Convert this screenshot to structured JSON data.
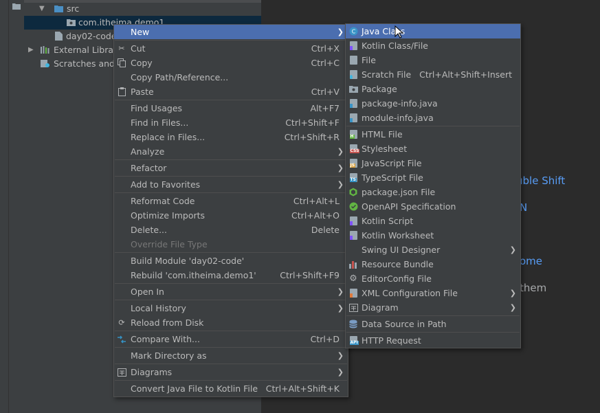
{
  "project_tree": {
    "src": "src",
    "package": "com.itheima.demo1",
    "module": "day02-code",
    "external": "External Librari",
    "scratches": "Scratches and C"
  },
  "editor_hints": [
    {
      "text": "uble Shift",
      "kind": "link"
    },
    {
      "text": "N",
      "kind": "link"
    },
    {
      "text": "ome",
      "kind": "link"
    },
    {
      "text": " them",
      "kind": "plain"
    }
  ],
  "context_menu": {
    "new": {
      "label": "New"
    },
    "cut": {
      "label": "Cut",
      "shortcut": "Ctrl+X"
    },
    "copy": {
      "label": "Copy",
      "shortcut": "Ctrl+C"
    },
    "copy_path": {
      "label": "Copy Path/Reference..."
    },
    "paste": {
      "label": "Paste",
      "shortcut": "Ctrl+V"
    },
    "find_usages": {
      "label": "Find Usages",
      "shortcut": "Alt+F7"
    },
    "find_in_files": {
      "label": "Find in Files...",
      "shortcut": "Ctrl+Shift+F"
    },
    "replace_in_files": {
      "label": "Replace in Files...",
      "shortcut": "Ctrl+Shift+R"
    },
    "analyze": {
      "label": "Analyze"
    },
    "refactor": {
      "label": "Refactor"
    },
    "add_to_favorites": {
      "label": "Add to Favorites"
    },
    "reformat_code": {
      "label": "Reformat Code",
      "shortcut": "Ctrl+Alt+L"
    },
    "optimize_imports": {
      "label": "Optimize Imports",
      "shortcut": "Ctrl+Alt+O"
    },
    "delete": {
      "label": "Delete...",
      "shortcut": "Delete"
    },
    "override_file_type": {
      "label": "Override File Type"
    },
    "build_module": {
      "label": "Build Module 'day02-code'"
    },
    "rebuild": {
      "label": "Rebuild 'com.itheima.demo1'",
      "shortcut": "Ctrl+Shift+F9"
    },
    "open_in": {
      "label": "Open In"
    },
    "local_history": {
      "label": "Local History"
    },
    "reload_from_disk": {
      "label": "Reload from Disk"
    },
    "compare_with": {
      "label": "Compare With...",
      "shortcut": "Ctrl+D"
    },
    "mark_directory_as": {
      "label": "Mark Directory as"
    },
    "diagrams": {
      "label": "Diagrams"
    },
    "convert_java_kotlin": {
      "label": "Convert Java File to Kotlin File",
      "shortcut": "Ctrl+Alt+Shift+K"
    }
  },
  "new_submenu": {
    "java_class": {
      "label": "Java Class"
    },
    "kotlin_class": {
      "label": "Kotlin Class/File"
    },
    "file": {
      "label": "File"
    },
    "scratch_file": {
      "label": "Scratch File",
      "shortcut": "Ctrl+Alt+Shift+Insert"
    },
    "package": {
      "label": "Package"
    },
    "package_info": {
      "label": "package-info.java"
    },
    "module_info": {
      "label": "module-info.java"
    },
    "html_file": {
      "label": "HTML File"
    },
    "stylesheet": {
      "label": "Stylesheet"
    },
    "javascript_file": {
      "label": "JavaScript File"
    },
    "typescript_file": {
      "label": "TypeScript File"
    },
    "package_json": {
      "label": "package.json File"
    },
    "openapi": {
      "label": "OpenAPI Specification"
    },
    "kotlin_script": {
      "label": "Kotlin Script"
    },
    "kotlin_worksheet": {
      "label": "Kotlin Worksheet"
    },
    "swing_ui_designer": {
      "label": "Swing UI Designer"
    },
    "resource_bundle": {
      "label": "Resource Bundle"
    },
    "editorconfig": {
      "label": "EditorConfig File"
    },
    "xml_config": {
      "label": "XML Configuration File"
    },
    "diagram": {
      "label": "Diagram"
    },
    "data_source": {
      "label": "Data Source in Path"
    },
    "http_request": {
      "label": "HTTP Request"
    }
  },
  "icon_badges": {
    "html": "H",
    "css": "CSS",
    "js": "JS",
    "ts": "TS",
    "api": "API",
    "java_class": "C"
  },
  "colors": {
    "highlight": "#4b6eaf",
    "menu_bg": "#3c3f41",
    "editor_bg": "#2b2b2b",
    "link": "#589df6"
  }
}
